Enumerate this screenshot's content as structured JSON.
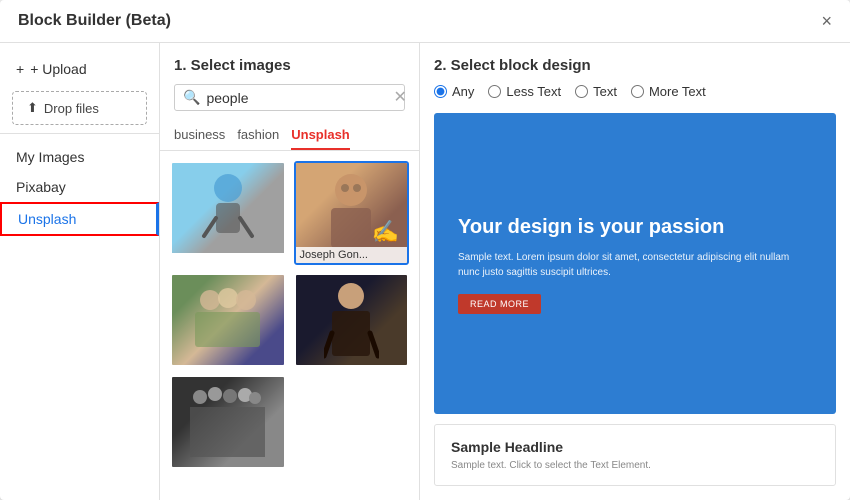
{
  "modal": {
    "title": "Block Builder (Beta)",
    "close_label": "×"
  },
  "sidebar": {
    "upload_label": "+ Upload",
    "drop_files_label": "Drop files",
    "my_images_label": "My Images",
    "pixabay_label": "Pixabay",
    "unsplash_label": "Unsplash"
  },
  "center_panel": {
    "title": "1. Select images",
    "search_placeholder": "people",
    "search_value": "people",
    "tabs": [
      {
        "id": "business",
        "label": "business"
      },
      {
        "id": "fashion",
        "label": "fashion"
      },
      {
        "id": "unsplash",
        "label": "Unsplash",
        "active": true
      }
    ],
    "images": [
      {
        "id": "img1",
        "caption": "",
        "class": "img-person-1",
        "selected": false
      },
      {
        "id": "img2",
        "caption": "Joseph Gon...",
        "class": "img-person-2",
        "selected": true
      },
      {
        "id": "img3",
        "caption": "",
        "class": "img-group-1",
        "selected": false
      },
      {
        "id": "img4",
        "caption": "",
        "class": "img-woman-1",
        "selected": false
      },
      {
        "id": "img5",
        "caption": "",
        "class": "img-people-2",
        "selected": false
      }
    ]
  },
  "right_panel": {
    "title": "2. Select block design",
    "radio_options": [
      {
        "id": "any",
        "label": "Any",
        "checked": true
      },
      {
        "id": "less_text",
        "label": "Less Text",
        "checked": false
      },
      {
        "id": "text",
        "label": "Text",
        "checked": false
      },
      {
        "id": "more_text",
        "label": "More Text",
        "checked": false
      }
    ],
    "preview_blue": {
      "heading": "Your design is your passion",
      "body": "Sample text. Lorem ipsum dolor sit amet, consectetur adipiscing elit nullam nunc justo sagittis suscipit ultrices.",
      "button_label": "READ MORE"
    },
    "preview_white": {
      "heading": "Sample Headline",
      "body": "Sample text. Click to select the Text Element."
    }
  }
}
